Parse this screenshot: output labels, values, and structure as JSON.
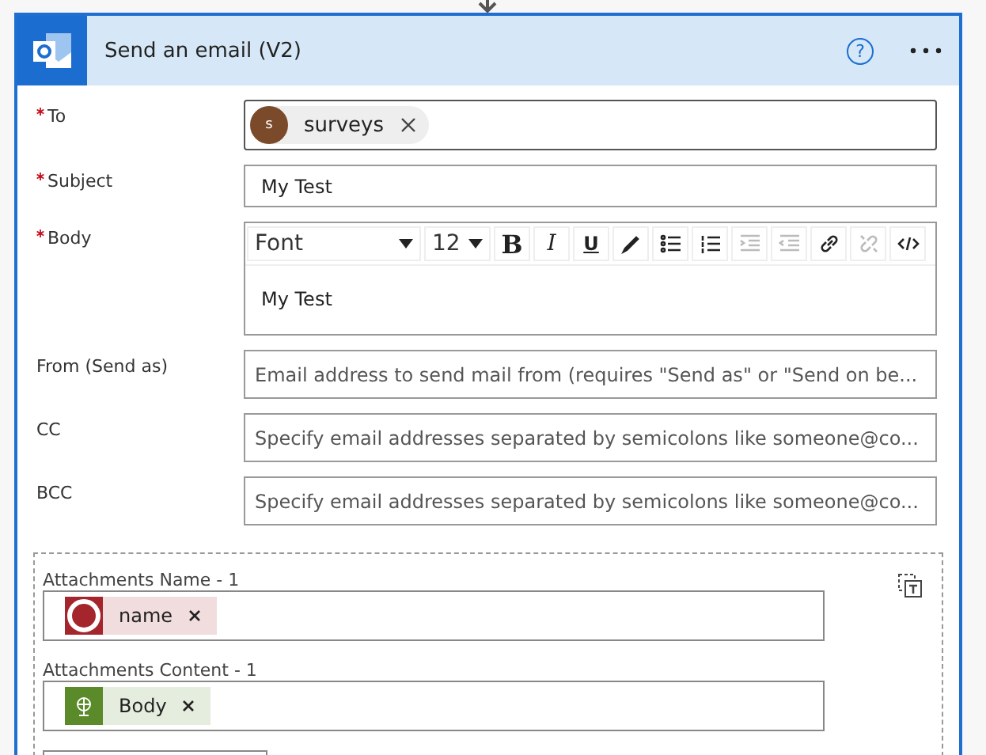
{
  "card": {
    "title": "Send an email (V2)",
    "help": "?"
  },
  "fields": [
    {
      "kind": "tokens",
      "label": "To",
      "required": true,
      "tokens": [
        {
          "text": "surveys",
          "initial": "s",
          "color": "#7b4a2b"
        }
      ]
    },
    {
      "kind": "text",
      "label": "Subject",
      "required": true,
      "value": "My Test"
    },
    {
      "kind": "rich",
      "label": "Body",
      "required": true,
      "font": "Font",
      "size": "12",
      "value": "My Test"
    },
    {
      "kind": "text",
      "label": "From (Send as)",
      "required": false,
      "placeholder": "Email address to send mail from (requires \"Send as\" or \"Send on be..."
    },
    {
      "kind": "text",
      "label": "CC",
      "required": false,
      "placeholder": "Specify email addresses separated by semicolons like someone@co..."
    },
    {
      "kind": "text",
      "label": "BCC",
      "required": false,
      "placeholder": "Specify email addresses separated by semicolons like someone@co..."
    }
  ],
  "toolbar": [
    {
      "kind": "bold",
      "text": "B",
      "disabled": false
    },
    {
      "kind": "italic",
      "text": "I",
      "disabled": false
    },
    {
      "kind": "underline",
      "text": "U",
      "disabled": false
    },
    {
      "kind": "color",
      "disabled": false
    },
    {
      "kind": "bullets",
      "disabled": false
    },
    {
      "kind": "numbers",
      "disabled": false
    },
    {
      "kind": "indent",
      "disabled": true
    },
    {
      "kind": "outdent",
      "disabled": true
    },
    {
      "kind": "link",
      "disabled": false
    },
    {
      "kind": "unlink",
      "disabled": true
    },
    {
      "kind": "code",
      "disabled": false
    }
  ],
  "attachments": [
    {
      "label": "Attachments Name - 1",
      "token": {
        "text": "name",
        "kind": "ring",
        "color": "#a4262c"
      }
    },
    {
      "label": "Attachments Content - 1",
      "token": {
        "text": "Body",
        "kind": "globe",
        "color": "#5a8a2a"
      }
    }
  ]
}
